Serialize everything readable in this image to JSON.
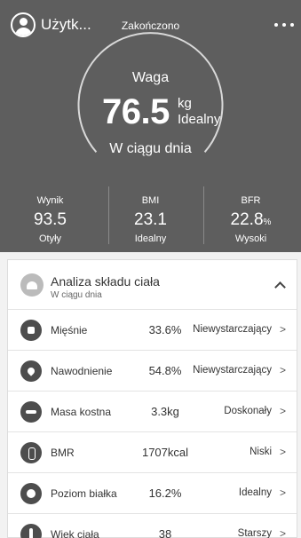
{
  "header": {
    "username": "Użytk...",
    "status_title": "Zakończono",
    "weight_label": "Waga",
    "weight_value": "76.5",
    "weight_unit": "kg",
    "weight_status": "Idealny",
    "period_label": "W ciągu dnia",
    "gauge_color": "#d9d9d9"
  },
  "metrics": [
    {
      "label": "Wynik",
      "value": "93.5",
      "unit": "",
      "status": "Otyły"
    },
    {
      "label": "BMI",
      "value": "23.1",
      "unit": "",
      "status": "Idealny"
    },
    {
      "label": "BFR",
      "value": "22.8",
      "unit": "%",
      "status": "Wysoki"
    }
  ],
  "analysis": {
    "title": "Analiza składu ciała",
    "subtitle": "W ciągu dnia",
    "rows": [
      {
        "name": "Mięśnie",
        "value": "33.6%",
        "status": "Niewystarczający",
        "arrow": ">",
        "icon": "muscle-icon"
      },
      {
        "name": "Nawodnienie",
        "value": "54.8%",
        "status": "Niewystarczający",
        "arrow": ">",
        "icon": "water-drop-icon"
      },
      {
        "name": "Masa kostna",
        "value": "3.3kg",
        "status": "Doskonały",
        "arrow": ">",
        "icon": "bone-icon"
      },
      {
        "name": "BMR",
        "value": "1707kcal",
        "status": "Niski",
        "arrow": ">",
        "icon": "flame-icon"
      },
      {
        "name": "Poziom białka",
        "value": "16.2%",
        "status": "Idealny",
        "arrow": ">",
        "icon": "protein-icon"
      },
      {
        "name": "Wiek ciała",
        "value": "38",
        "status": "Starszy",
        "arrow": ">",
        "icon": "body-age-icon"
      }
    ]
  }
}
